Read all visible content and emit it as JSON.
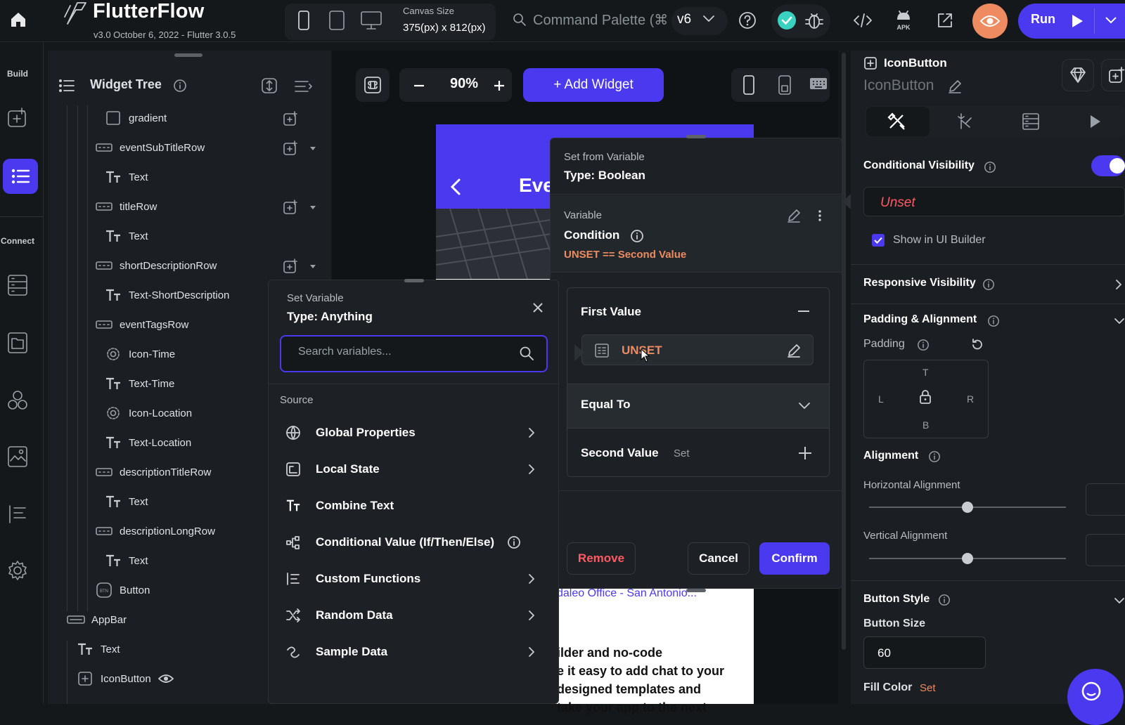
{
  "app": {
    "title": "FlutterFlow",
    "version": "v3.0 October 6, 2022 - Flutter 3.0.5",
    "canvas_size_label": "Canvas Size",
    "canvas_size_value": "375(px) x 812(px)",
    "command_palette": "Command Palette (⌘",
    "v6_label": "v6",
    "run_label": "Run"
  },
  "rail": {
    "build_label": "Build",
    "connect_label": "Connect"
  },
  "widget_tree": {
    "title": "Widget Tree",
    "items": [
      {
        "label": "gradient"
      },
      {
        "label": "eventSubTitleRow"
      },
      {
        "label": "Text"
      },
      {
        "label": "titleRow"
      },
      {
        "label": "Text"
      },
      {
        "label": "shortDescriptionRow"
      },
      {
        "label": "Text-ShortDescription"
      },
      {
        "label": "eventTagsRow"
      },
      {
        "label": "Icon-Time"
      },
      {
        "label": "Text-Time"
      },
      {
        "label": "Icon-Location"
      },
      {
        "label": "Text-Location"
      },
      {
        "label": "descriptionTitleRow"
      },
      {
        "label": "Text"
      },
      {
        "label": "descriptionLongRow"
      },
      {
        "label": "Text"
      },
      {
        "label": "Button"
      },
      {
        "label": "AppBar"
      },
      {
        "label": "Text"
      },
      {
        "label": "IconButton"
      }
    ]
  },
  "toolbar": {
    "zoom": "90%",
    "add_widget": "+ Add Widget"
  },
  "phone": {
    "title_partial": "Eve",
    "link_text": "daleo Office - San Antonio...",
    "body_lines": [
      "ilder and no-code",
      "e it easy to add chat to your",
      "designed templates and",
      "take your app to the next"
    ]
  },
  "set_variable": {
    "title": "Set Variable",
    "type": "Type: Anything",
    "search_placeholder": "Search variables...",
    "source_label": "Source",
    "items": [
      {
        "label": "Global Properties",
        "icon": "globe-icon",
        "chevron": true
      },
      {
        "label": "Local State",
        "icon": "local-state-icon",
        "chevron": true
      },
      {
        "label": "Combine Text",
        "icon": "text-icon",
        "chevron": false
      },
      {
        "label": "Conditional Value (If/Then/Else)",
        "icon": "conditional-icon",
        "chevron": false
      },
      {
        "label": "Custom Functions",
        "icon": "functions-icon",
        "chevron": true
      },
      {
        "label": "Random Data",
        "icon": "shuffle-icon",
        "chevron": true
      },
      {
        "label": "Sample Data",
        "icon": "sample-icon",
        "chevron": true
      }
    ]
  },
  "condition": {
    "header": "Set from Variable",
    "type": "Type: Boolean",
    "variable_label": "Variable",
    "condition_label": "Condition",
    "expression": "UNSET == Second Value",
    "first_value": "First Value",
    "first_value_chip": "UNSET",
    "operator": "Equal To",
    "second_value": "Second Value",
    "second_value_status": "Set",
    "remove": "Remove",
    "cancel": "Cancel",
    "confirm": "Confirm"
  },
  "properties": {
    "widget_type": "IconButton",
    "widget_name": "IconButton",
    "conditional_visibility": "Conditional Visibility",
    "unset": "Unset",
    "show_in_ui_builder": "Show in UI Builder",
    "responsive_visibility": "Responsive Visibility",
    "padding_alignment": "Padding & Alignment",
    "padding": "Padding",
    "pad_t": "T",
    "pad_l": "L",
    "pad_r": "R",
    "pad_b": "B",
    "alignment": "Alignment",
    "horizontal_alignment": "Horizontal Alignment",
    "vertical_alignment": "Vertical Alignment",
    "button_style": "Button Style",
    "button_size": "Button Size",
    "button_size_value": "60",
    "fill_color": "Fill Color",
    "fill_color_status": "Set"
  },
  "colors": {
    "primary": "#4b39ef",
    "error": "#ff5963",
    "warning": "#ee8b60",
    "success": "#39d2c0"
  }
}
